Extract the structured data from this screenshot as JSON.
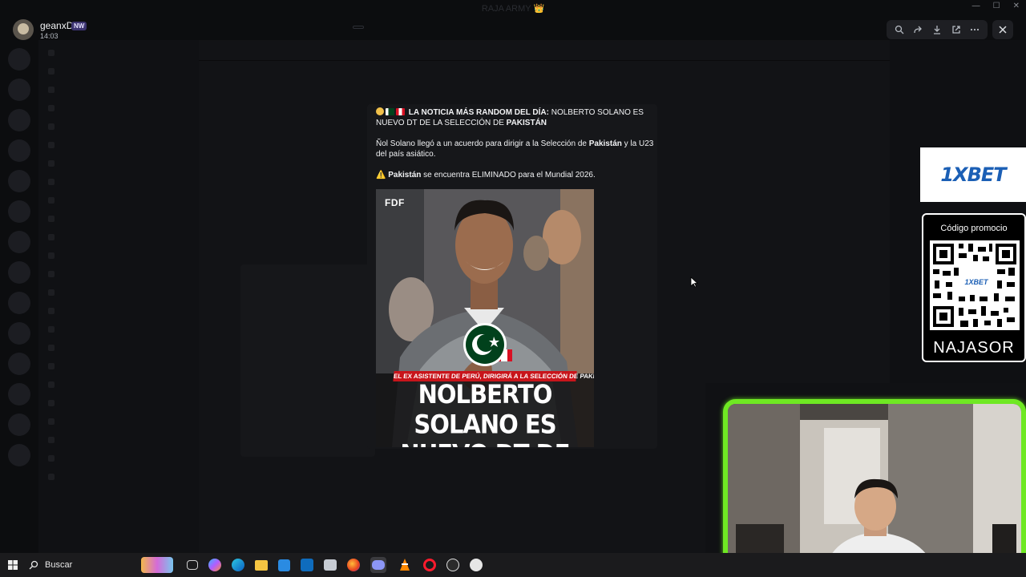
{
  "window": {
    "title": "RAJA ARMY 👑"
  },
  "viewer": {
    "user_name": "geanxD",
    "user_badge": "NW",
    "time": "14:03"
  },
  "post": {
    "headline_prefix": "LA NOTICIA MÁS RANDOM DEL DÍA:",
    "headline_rest": "NOLBERTO SOLANO ES NUEVO DT DE LA SELECCIÓN DE",
    "headline_country": "PAKISTÁN",
    "para2_start": "Ñol Solano llegó a un acuerdo para dirigir a la Selección de",
    "para2_country": "Pakistán",
    "para2_end": "y la U23 del país asiático.",
    "para3_warn_icon": "⚠️",
    "para3_country": "Pakistán",
    "para3_end": "se encuentra ELIMINADO para el Mundial 2026.",
    "image": {
      "brand": "FDF",
      "subtitle": "EL EX ASISTENTE DE PERÚ, DIRIGIRÁ A LA SELECCIÓN DE PAKISTÁN",
      "headline_line1": "NOLBERTO SOLANO ES",
      "headline_line2": "NUEVO DT DE PAKISTÁN"
    }
  },
  "ads": {
    "logo_text": "1XBET",
    "qr_title": "Código promocio",
    "qr_inner": "1XBET",
    "promo_code": "NAJASOR"
  },
  "taskbar": {
    "search_label": "Buscar"
  },
  "colors": {
    "webcam_border": "#6fe823",
    "brand_blue": "#1b5fb5",
    "news_red": "#c8151b"
  }
}
